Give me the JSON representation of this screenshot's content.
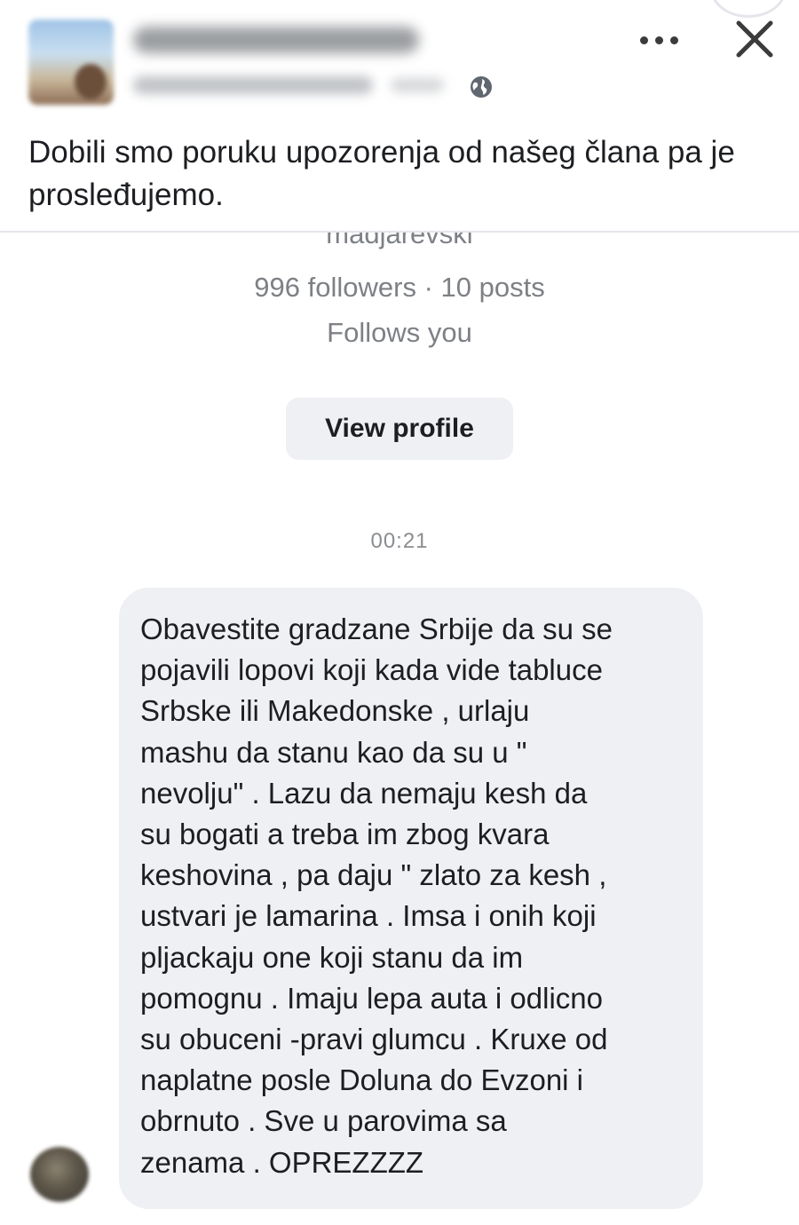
{
  "post": {
    "text": "Dobili smo poruku upozorenja od našeg člana pa je prosleđujemo."
  },
  "conversation": {
    "username": "madjarevski",
    "followers_line": "996 followers · 10 posts",
    "follows_line": "Follows you",
    "view_profile_label": "View profile",
    "timestamp": "00:21",
    "message": "Obavestite gradzane Srbije da su se\npojavili lopovi koji kada vide tabluce\nSrbske ili Makedonske , urlaju\nmashu da stanu kao da su u \"\nnevolju\" . Lazu da nemaju kesh da\nsu bogati a treba im zbog kvara\nkeshovina , pa daju \" zlato za kesh ,\nustvari je lamarina . Imsa i onih koji\npljackaju one koji stanu da im\npomognu . Imaju lepa auta i odlicno\nsu obuceni -pravi glumcu . Kruxe od\nnaplatne posle Doluna do Evzoni i\nobrnuto . Sve u parovima sa\nzenama . OPREZZZZ"
  },
  "icons": {
    "globe": "globe-icon",
    "more": "more-options-icon",
    "close": "close-icon"
  },
  "colors": {
    "bubble": "#eef0f3",
    "secondary_text": "#7d8085"
  }
}
